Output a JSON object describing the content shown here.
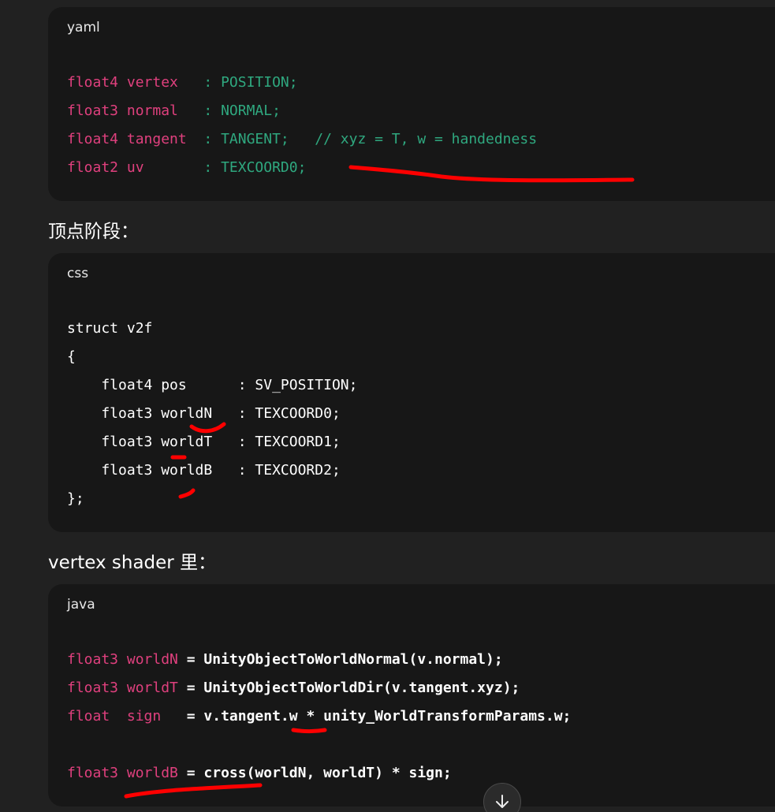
{
  "blocks": [
    {
      "lang": "yaml",
      "lines": [
        [
          {
            "t": "float4 vertex   ",
            "c": "kw"
          },
          {
            "t": ": POSITION;",
            "c": "cm"
          }
        ],
        [
          {
            "t": "float3 normal   ",
            "c": "kw"
          },
          {
            "t": ": NORMAL;",
            "c": "cm"
          }
        ],
        [
          {
            "t": "float4 tangent  ",
            "c": "kw"
          },
          {
            "t": ": TANGENT;   // xyz = T, w = handedness",
            "c": "cm"
          }
        ],
        [
          {
            "t": "float2 uv       ",
            "c": "kw"
          },
          {
            "t": ": TEXCOORD0;",
            "c": "cm"
          }
        ]
      ]
    },
    {
      "lang": "css",
      "lines": [
        [
          {
            "t": "struct v2f",
            "c": "tl"
          }
        ],
        [
          {
            "t": "{",
            "c": "tl"
          }
        ],
        [
          {
            "t": "    float4 pos      : SV_POSITION;",
            "c": "tl"
          }
        ],
        [
          {
            "t": "    float3 worldN   : TEXCOORD0;",
            "c": "tl"
          }
        ],
        [
          {
            "t": "    float3 worldT   : TEXCOORD1;",
            "c": "tl"
          }
        ],
        [
          {
            "t": "    float3 worldB   : TEXCOORD2;",
            "c": "tl"
          }
        ],
        [
          {
            "t": "};",
            "c": "tl"
          }
        ]
      ]
    },
    {
      "lang": "java",
      "lines": [
        [
          {
            "t": "float3 worldN",
            "c": "kw"
          },
          {
            "t": " = UnityObjectToWorldNormal(v.normal);",
            "c": "bold"
          }
        ],
        [
          {
            "t": "float3 worldT",
            "c": "kw"
          },
          {
            "t": " = UnityObjectToWorldDir(v.tangent.xyz);",
            "c": "bold"
          }
        ],
        [
          {
            "t": "float  sign",
            "c": "kw"
          },
          {
            "t": "   = v.tangent.w * unity_WorldTransformParams.w;",
            "c": "bold"
          }
        ],
        [
          {
            "t": "",
            "c": "tl"
          }
        ],
        [
          {
            "t": "float3 worldB",
            "c": "kw"
          },
          {
            "t": " = cross(worldN, worldT) * sign;",
            "c": "bold"
          }
        ]
      ]
    }
  ],
  "headings": {
    "vertex_stage": "顶点阶段：",
    "vertex_shader": "vertex shader 里："
  },
  "icons": {
    "scroll_down": "arrow-down-icon"
  },
  "colors": {
    "background": "#212121",
    "code_background": "#171717",
    "keyword": "#e0407e",
    "comment": "#2fa87f",
    "annotation_ink": "#ff0000"
  }
}
